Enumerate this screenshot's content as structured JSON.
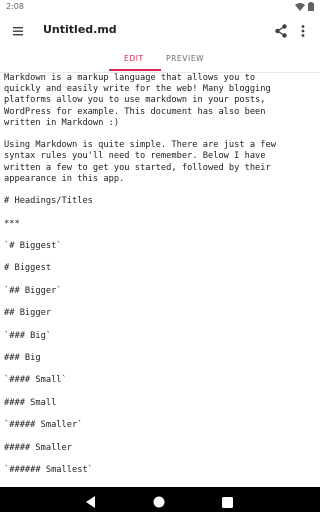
{
  "status_bar": {
    "time": "2:08",
    "icons": [
      "wifi-icon",
      "battery-icon"
    ]
  },
  "app_bar": {
    "title": "Untitled.md",
    "menu_icon": "hamburger-menu-icon",
    "share_icon": "share-icon",
    "more_icon": "more-vert-icon"
  },
  "tabs": [
    {
      "label": "EDIT",
      "active": true
    },
    {
      "label": "PREVIEW",
      "active": false
    }
  ],
  "colors": {
    "accent": "#d62a52",
    "text": "#222222",
    "nav_bar": "#000000"
  },
  "editor": {
    "lines": [
      "Markdown is a markup language that allows you to",
      "quickly and easily write for the web! Many blogging",
      "platforms allow you to use markdown in your posts,",
      "WordPress for example. This document has also been",
      "written in Markdown :)",
      "",
      "Using Markdown is quite simple. There are just a few",
      "syntax rules you'll need to remember. Below I have",
      "written a few to get you started, followed by their",
      "appearance in this app.",
      "",
      "# Headings/Titles",
      "",
      "***",
      "",
      "`# Biggest`",
      "",
      "# Biggest",
      "",
      "`## Bigger`",
      "",
      "## Bigger",
      "",
      "`### Big`",
      "",
      "### Big",
      "",
      "`#### Small`",
      "",
      "#### Small",
      "",
      "`##### Smaller`",
      "",
      "##### Smaller",
      "",
      "`###### Smallest`"
    ]
  },
  "nav_bar": {
    "icons": [
      "back-icon",
      "home-icon",
      "recents-icon"
    ]
  }
}
